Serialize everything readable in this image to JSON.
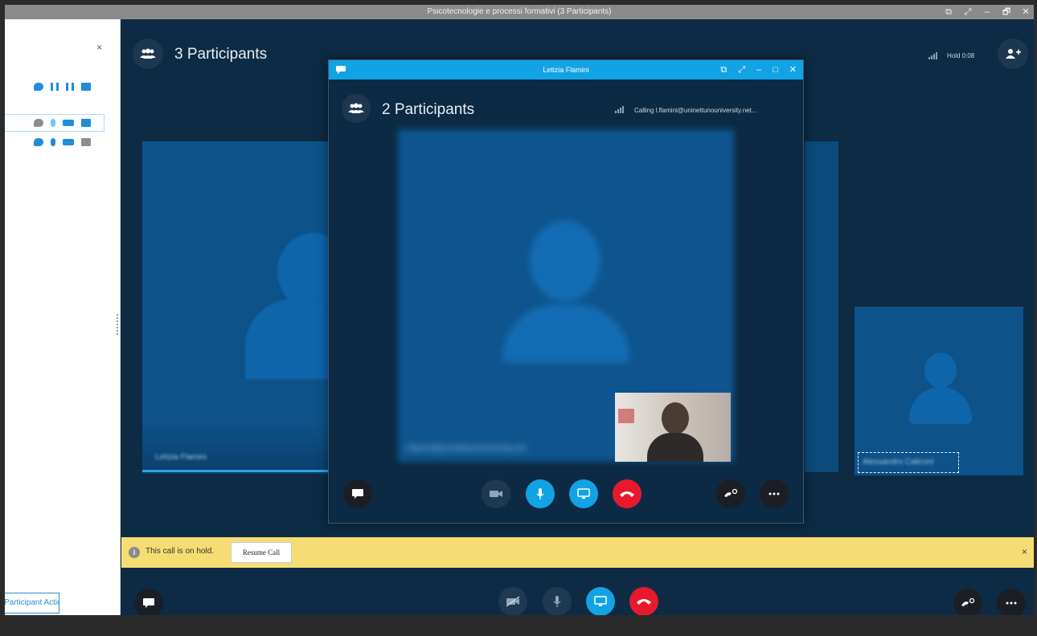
{
  "window": {
    "title": "Psicotecnologie e processi formativi (3 Participants)",
    "controls": [
      "⧉",
      "⤢",
      "–",
      "🗗",
      "✕"
    ]
  },
  "sidepanel": {
    "close_label": "×",
    "participant_actions_label": "Participant Actions"
  },
  "main": {
    "participants_label": "3 Participants",
    "hold_status": "Hold 0:08",
    "left_tile_name": "Letizia Flamini",
    "right_tile_name": "Alessandro Caliconi"
  },
  "popup": {
    "title": "Letizia Flamini",
    "participants_label": "2 Participants",
    "calling_status": "Calling l.flamini@uninettunouniversity.net...",
    "caller_address": "l.flamini@uninettunouniversity.net"
  },
  "holdbar": {
    "info_glyph": "i",
    "message": "This call is on hold.",
    "resume_label": "Resume Call",
    "close_label": "×"
  },
  "colors": {
    "accent_blue": "#12a3e5",
    "hangup_red": "#e8192c",
    "hold_yellow": "#f6dd73",
    "stage_navy": "#0d2b45",
    "tile_blue": "#0d5289"
  },
  "icons": {
    "chat": "chat-bubble-icon",
    "video": "video-camera-icon",
    "mic": "microphone-icon",
    "present": "monitor-present-icon",
    "hangup": "phone-hangup-icon",
    "transfer": "phone-transfer-icon",
    "more": "ellipsis-icon",
    "people": "participants-icon",
    "add_person": "add-person-icon",
    "signal": "signal-strength-icon"
  }
}
